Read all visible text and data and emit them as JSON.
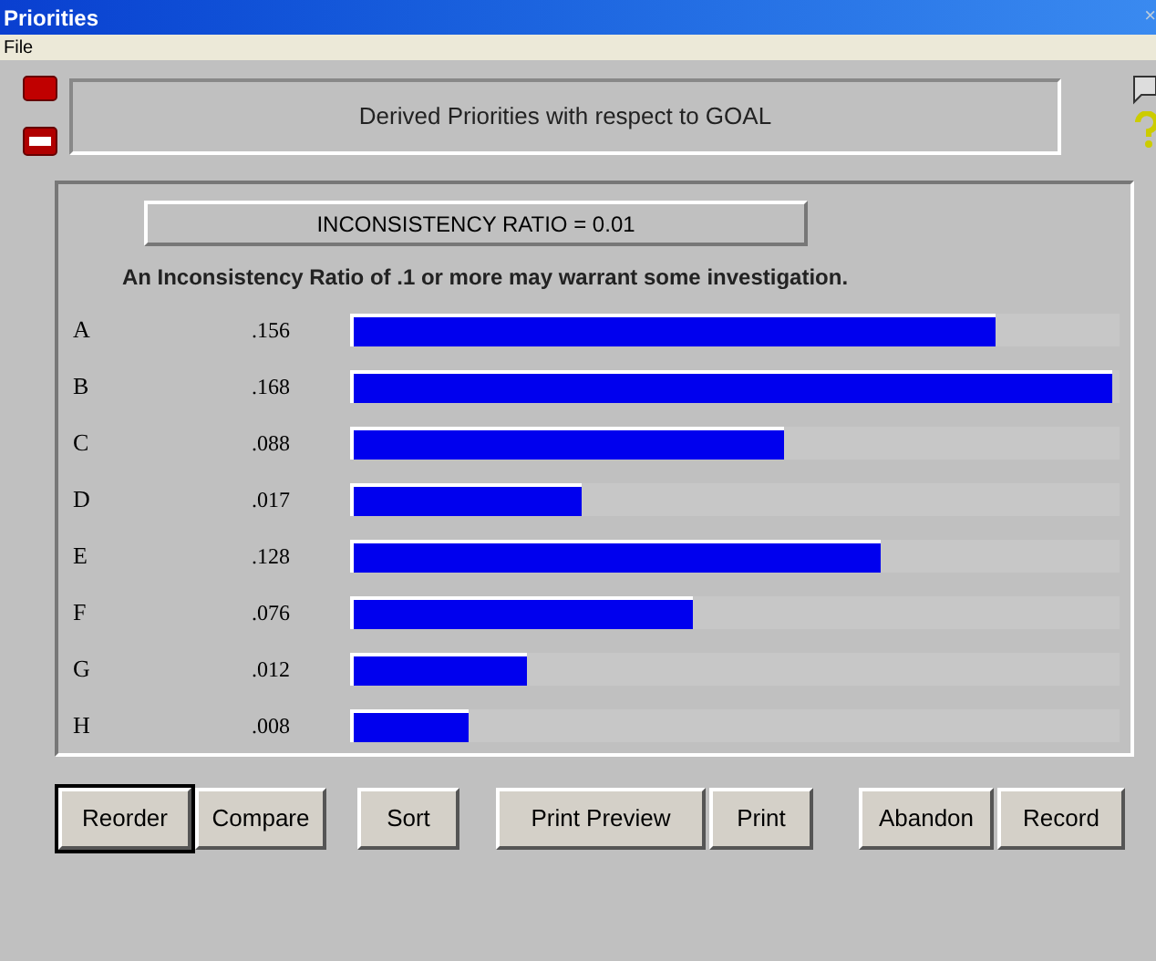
{
  "window": {
    "title": "Priorities",
    "close": "×"
  },
  "menu": [
    "File"
  ],
  "header": "Derived Priorities with respect to GOAL",
  "ratio": "INCONSISTENCY RATIO = 0.01",
  "note": "An Inconsistency Ratio of .1 or more may warrant some investigation.",
  "rows": [
    {
      "label": "A",
      "value": ".156",
      "level": 0.84
    },
    {
      "label": "B",
      "value": ".168",
      "level": 0.99
    },
    {
      "label": "C",
      "value": ".088",
      "level": 0.565
    },
    {
      "label": "D",
      "value": ".017",
      "level": 0.3
    },
    {
      "label": "E",
      "value": ".128",
      "level": 0.69
    },
    {
      "label": "F",
      "value": ".076",
      "level": 0.445
    },
    {
      "label": "G",
      "value": ".012",
      "level": 0.23
    },
    {
      "label": "H",
      "value": ".008",
      "level": 0.155
    }
  ],
  "buttons": [
    {
      "label": "Reorder",
      "selected": true
    },
    {
      "label": "Compare",
      "selected": false
    },
    {
      "label": "Sort",
      "selected": false
    },
    {
      "label": "Print Preview",
      "selected": false
    },
    {
      "label": "Print",
      "selected": false
    },
    {
      "label": "Abandon",
      "selected": false
    },
    {
      "label": "Record",
      "selected": false
    }
  ]
}
